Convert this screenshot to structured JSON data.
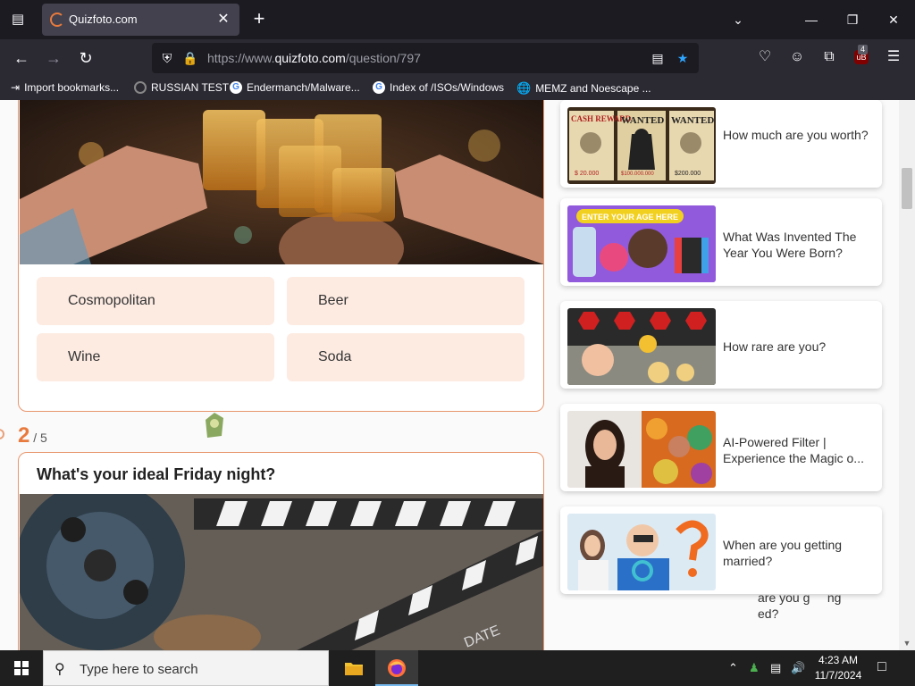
{
  "browser": {
    "tab": {
      "title": "Quizfoto.com"
    },
    "address": {
      "prefix": "https://www.",
      "host": "quizfoto.com",
      "path": "/question/797"
    },
    "extensions_badge": "4",
    "bookmarks": [
      {
        "label": "Import bookmarks..."
      },
      {
        "label": "RUSSIAN TEST"
      },
      {
        "label": "Endermanch/Malware..."
      },
      {
        "label": "Index of /ISOs/Windows"
      },
      {
        "label": "MEMZ and Noescape ..."
      }
    ]
  },
  "quiz": {
    "question1": {
      "answers": [
        "Cosmopolitan",
        "Beer",
        "Wine",
        "Soda"
      ]
    },
    "progress": {
      "current": "2",
      "total": "/ 5"
    },
    "question2": {
      "title": "What's your ideal Friday night?"
    }
  },
  "sidebar": {
    "items": [
      {
        "title": "How much are you worth?"
      },
      {
        "title": "What Was Invented The Year You Were Born?"
      },
      {
        "title": "How rare are you?"
      },
      {
        "title": "AI-Powered Filter | Experience the Magic o..."
      },
      {
        "title": "When are you getting married?"
      }
    ],
    "ghost_text": "are you g     ng\ned?"
  },
  "taskbar": {
    "search_placeholder": "Type here to search",
    "time": "4:23 AM",
    "date": "11/7/2024"
  },
  "colors": {
    "accent": "#e87a3d",
    "answer_bg": "#fdebe2",
    "chrome_dark": "#1c1b22",
    "chrome_mid": "#2b2a33"
  }
}
